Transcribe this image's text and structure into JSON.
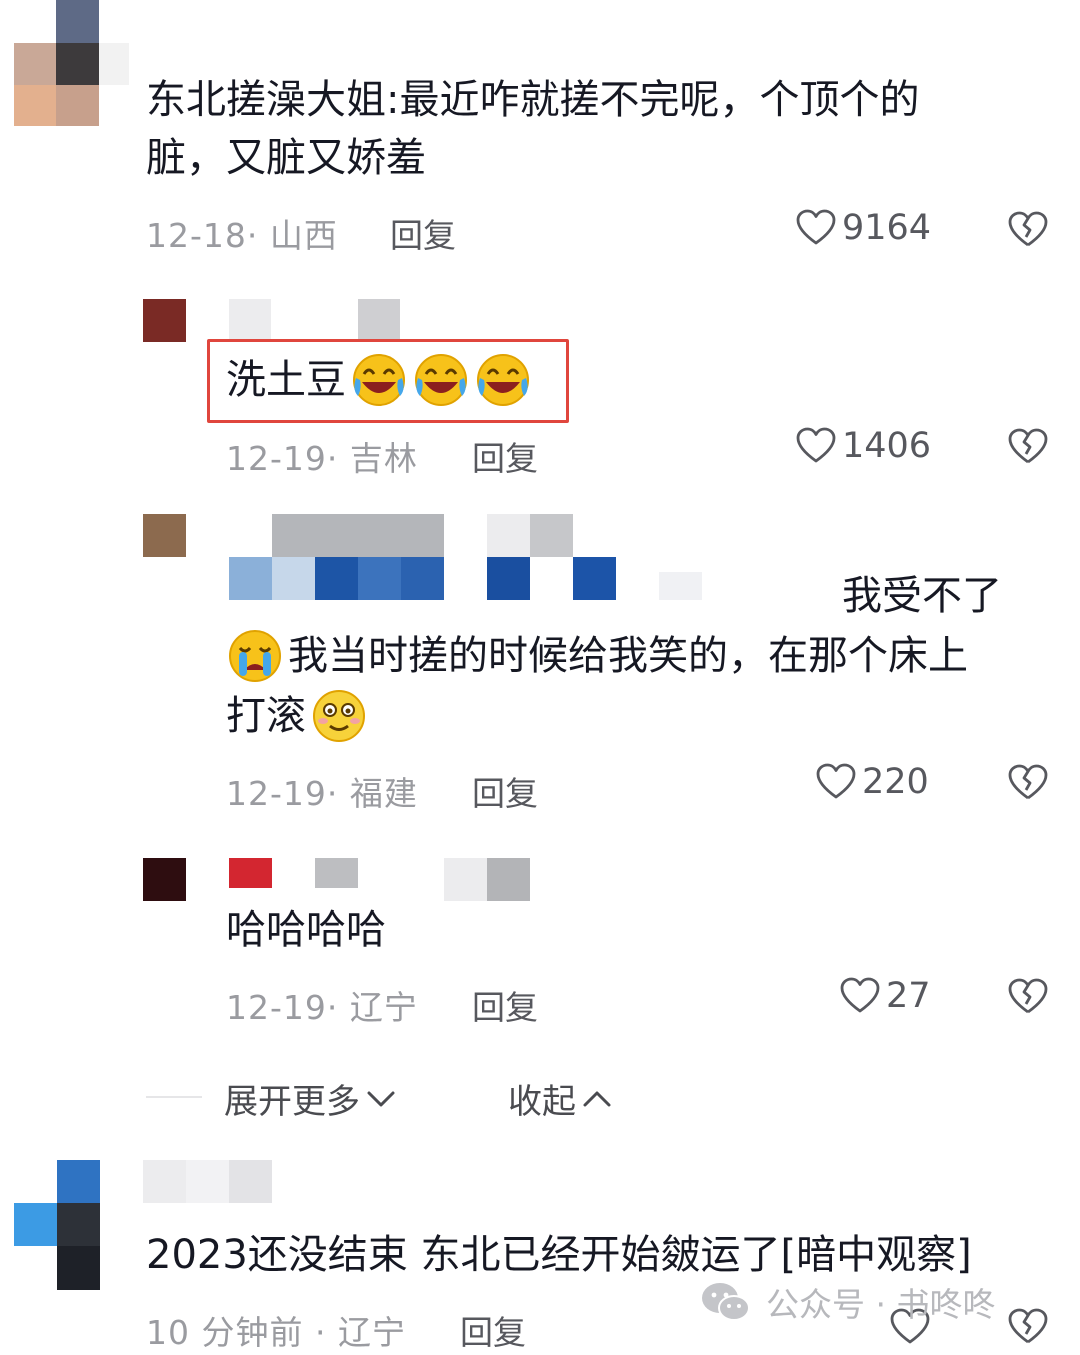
{
  "comments": [
    {
      "text_line1": "东北搓澡大姐:最近咋就搓不完呢，个顶个的",
      "text_line2": "脏，又脏又娇羞",
      "date_location": "12-18· 山西",
      "reply_label": "回复",
      "likes": "9164"
    },
    {
      "text": "洗土豆",
      "date_location": "12-19· 吉林",
      "reply_label": "回复",
      "likes": "1406"
    },
    {
      "text_line1_tail": "我受不了",
      "text_line2": "我当时搓的时候给我笑的，在那个床上",
      "text_line3": "打滚",
      "date_location": "12-19· 福建",
      "reply_label": "回复",
      "likes": "220"
    },
    {
      "text": "哈哈哈哈",
      "date_location": "12-19· 辽宁",
      "reply_label": "回复",
      "likes": "27"
    },
    {
      "text": "2023还没结束 东北已经开始皴运了[暗中观察]",
      "date_location": "10 分钟前 · 辽宁",
      "reply_label": "回复"
    }
  ],
  "thread_controls": {
    "expand_label": "展开更多",
    "collapse_label": "收起"
  },
  "watermark": {
    "text": "公众号 · 书咚咚"
  },
  "colors": {
    "highlight_border": "#e0463d",
    "meta_gray": "#9a9ba0"
  }
}
